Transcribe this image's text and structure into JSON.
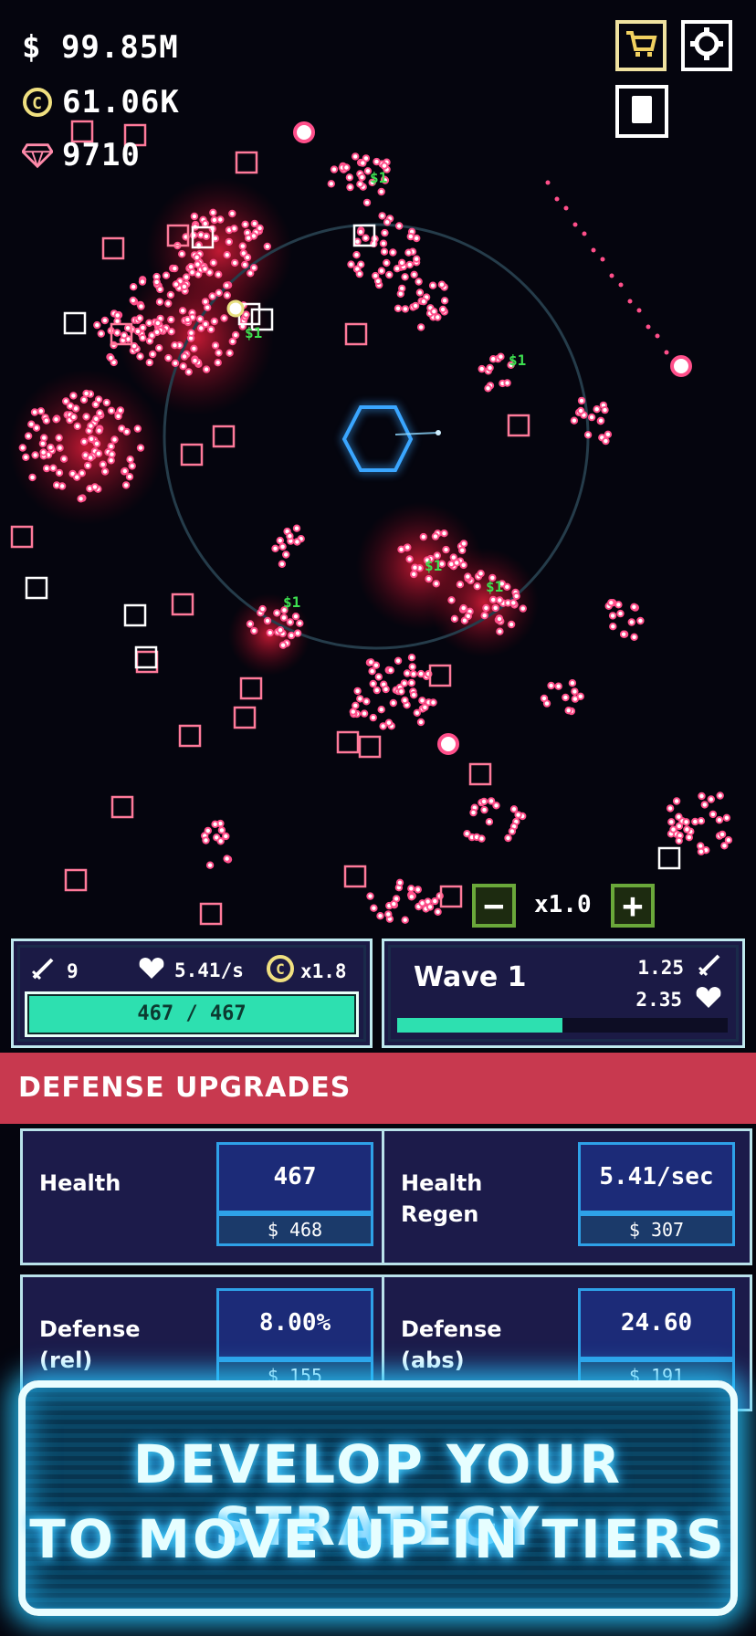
{
  "hud": {
    "cash": "$ 99.85M",
    "coins": "61.06K",
    "gems": "9710"
  },
  "speed": {
    "minus": "−",
    "value": "x1.0",
    "plus": "+"
  },
  "floating_labels": [
    "$1",
    "$1",
    "$1",
    "$1",
    "$1",
    "$1"
  ],
  "tower_panel": {
    "damage": "9",
    "regen": "5.41/s",
    "coin_mult": "x1.8",
    "health_bar_text": "467 / 467",
    "health_fraction": 1.0
  },
  "wave_panel": {
    "title": "Wave 1",
    "enemy_damage": "1.25",
    "enemy_health": "2.35",
    "progress_fraction": 0.5
  },
  "upgrades": {
    "header": "DEFENSE UPGRADES",
    "cards": [
      {
        "name_line1": "Health",
        "name_line2": "",
        "value": "467",
        "cost": "$ 468"
      },
      {
        "name_line1": "Health",
        "name_line2": "Regen",
        "value": "5.41/sec",
        "cost": "$ 307"
      },
      {
        "name_line1": "Defense",
        "name_line2": "(rel)",
        "value": "8.00%",
        "cost": "$ 155"
      },
      {
        "name_line1": "Defense",
        "name_line2": "(abs)",
        "value": "24.60",
        "cost": "$ 191"
      }
    ]
  },
  "banner": {
    "line1": "DEVELOP YOUR STRATEGY",
    "line2": "TO MOVE UP IN TIERS"
  },
  "colors": {
    "enemy": "#ff4f8a",
    "tower": "#3aa6ff",
    "health_bar": "#2de0b0",
    "header": "#c8394f",
    "banner_glow": "#2ac8ff"
  }
}
